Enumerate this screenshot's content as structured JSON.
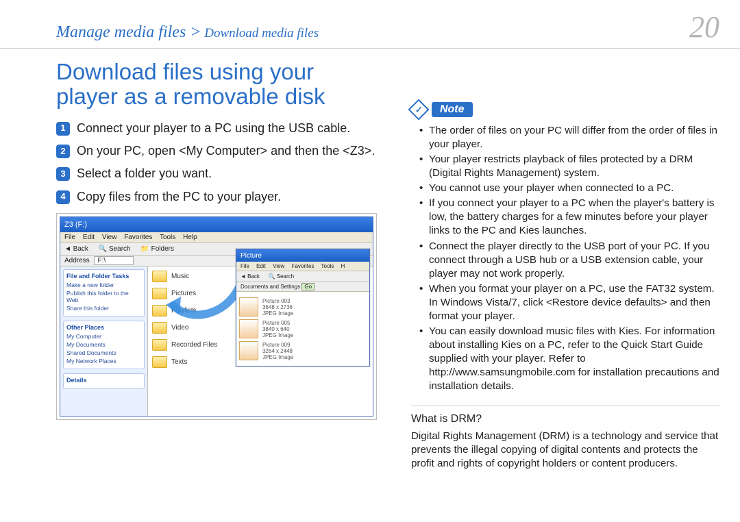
{
  "header": {
    "breadcrumb_main": "Manage media files >",
    "breadcrumb_sub": " Download media files",
    "page_number": "20"
  },
  "left": {
    "title": "Download files using your player as a removable disk",
    "steps": [
      "Connect your player to a PC using the USB cable.",
      "On your PC, open <My Computer> and then the <Z3>.",
      "Select a folder you want.",
      "Copy files from the PC to your player."
    ],
    "mock": {
      "win_title": "Z3 (F:)",
      "menu": [
        "File",
        "Edit",
        "View",
        "Favorites",
        "Tools",
        "Help"
      ],
      "toolbar": [
        "Back",
        "▾",
        "",
        "Search",
        "Folders",
        "",
        "▾"
      ],
      "address_label": "Address",
      "address_value": "F:\\",
      "side": {
        "box1_title": "File and Folder Tasks",
        "box1_items": [
          "Make a new folder",
          "Publish this folder to the Web",
          "Share this folder"
        ],
        "box2_title": "Other Places",
        "box2_items": [
          "My Computer",
          "My Documents",
          "Shared Documents",
          "My Network Places"
        ],
        "box3_title": "Details"
      },
      "folders": [
        "Music",
        "Pictures",
        "Playlists",
        "Video",
        "Recorded Files",
        "Texts"
      ],
      "win2_title": "Picture",
      "win2_menu": [
        "File",
        "Edit",
        "View",
        "Favorites",
        "Tools",
        "H"
      ],
      "win2_toolbar": [
        "Back",
        "▾",
        "",
        "Search"
      ],
      "win2_addr": "Documents and Settings",
      "thumbs": [
        {
          "name": "Picture 003",
          "dim": "3648 x 2736",
          "type": "JPEG Image"
        },
        {
          "name": "Picture 005",
          "dim": "3840 x 640",
          "type": "JPEG Image"
        },
        {
          "name": "Picture 009",
          "dim": "3264 x 2448",
          "type": "JPEG Image"
        }
      ]
    }
  },
  "right": {
    "note_label": "Note",
    "notes": [
      "The order of files on your PC will differ from the order of files in your player.",
      "Your player restricts playback of files protected by a DRM (Digital Rights Management) system.",
      "You cannot use your player when connected to a PC.",
      "If you connect your player to a PC when the player's battery is low, the battery charges for a few minutes before your player links to the PC and Kies launches.",
      "Connect the player directly to the USB port of your PC. If you connect through a USB hub or a USB extension cable, your player may not work properly.",
      "When you format your player on a PC, use the FAT32 system. In Windows Vista/7, click <Restore device defaults> and then format your player.",
      "You can easily download music files with Kies. For information about installing Kies on a PC, refer to the Quick Start Guide supplied with your player. Refer to http://www.samsungmobile.com for installation precautions and installation details."
    ],
    "drm_title": "What is DRM?",
    "drm_body": "Digital Rights Management (DRM) is a technology and service that prevents the illegal copying of digital contents and protects the profit and rights of copyright holders or content producers."
  }
}
